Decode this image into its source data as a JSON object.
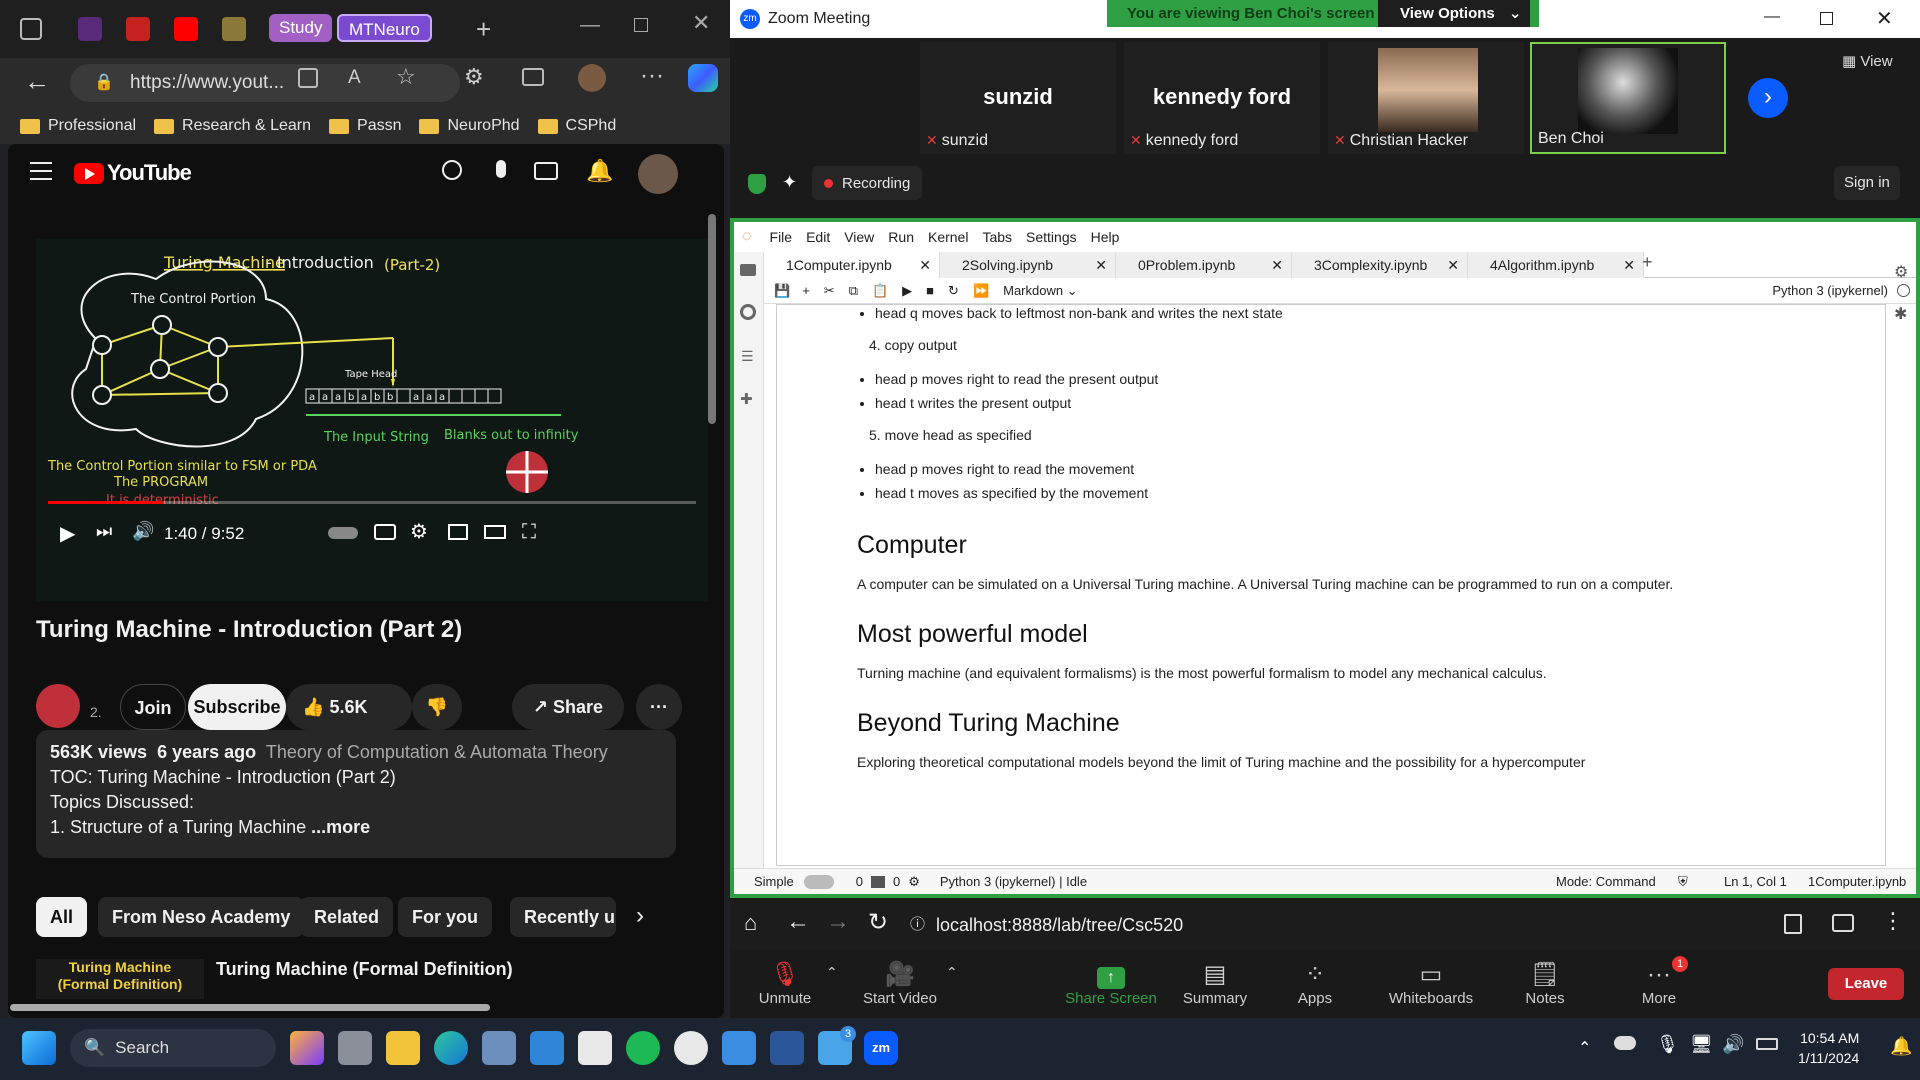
{
  "browser": {
    "group_tabs": [
      "Study",
      "MTNeuro"
    ],
    "url": "https://www.yout...",
    "bookmarks": [
      "Professional",
      "Research & Learn",
      "Passn",
      "NeuroPhd",
      "CSPhd"
    ]
  },
  "youtube": {
    "logo": "YouTube",
    "video": {
      "slide_title": "Turing Machine",
      "slide_title_rest": " - Introduction",
      "slide_part": "(Part-2)",
      "control_portion": "The Control Portion",
      "tape_head": "Tape Head",
      "tape_cells": [
        "a",
        "a",
        "a",
        "b",
        "a",
        "b",
        "b",
        "",
        "a",
        "a",
        "a",
        "",
        "",
        "",
        ""
      ],
      "input_string": "The Input String",
      "blanks": "Blanks out to infinity",
      "note1": "The Control Portion similar to FSM or PDA",
      "note2": "The PROGRAM",
      "note3": "It is deterministic",
      "time": "1:40 / 9:52",
      "progress_fraction": 0.177
    },
    "title": "Turing Machine - Introduction (Part 2)",
    "channel_sub": "2.",
    "join": "Join",
    "subscribe": "Subscribe",
    "likes": "5.6K",
    "share": "Share",
    "description": {
      "views": "563K views",
      "age": "6 years ago",
      "playlist": "Theory of Computation & Automata Theory",
      "line1": "TOC: Turing Machine - Introduction (Part 2)",
      "line2": "Topics Discussed:",
      "line3": "1. Structure of a Turing Machine",
      "more": "...more"
    },
    "chips": [
      "All",
      "From Neso Academy",
      "Related",
      "For you",
      "Recently upl"
    ],
    "next_video": {
      "thumb_line1": "Turing Machine",
      "thumb_line2": "(Formal Definition)",
      "title": "Turing Machine (Formal Definition)"
    }
  },
  "zoom": {
    "window_title": "Zoom Meeting",
    "banner": "You are viewing Ben Choi's screen",
    "view_options": "View Options",
    "view": "View",
    "participants": [
      {
        "big": "sunzid",
        "label": "sunzid"
      },
      {
        "big": "kennedy ford",
        "label": "kennedy ford"
      },
      {
        "big": "",
        "label": "Christian Hacker"
      },
      {
        "big": "",
        "label": "Ben Choi"
      }
    ],
    "recording": "Recording",
    "sign_in": "Sign in",
    "jupyter": {
      "menu": [
        "File",
        "Edit",
        "View",
        "Run",
        "Kernel",
        "Tabs",
        "Settings",
        "Help"
      ],
      "tabs": [
        "1Computer.ipynb",
        "2Solving.ipynb",
        "0Problem.ipynb",
        "3Complexity.ipynb",
        "4Algorithm.ipynb"
      ],
      "cell_type": "Markdown",
      "kernel": "Python 3 (ipykernel)",
      "content": {
        "b0": "head q moves back to leftmost non-bank and writes the next state",
        "item4": "4. copy output",
        "b1": "head p moves right to read the present output",
        "b2": "head t writes the present output",
        "item5": "5. move head as specified",
        "b3": "head p moves right to read the movement",
        "b4": "head t moves as specified by the movement",
        "h1": "Computer",
        "p1": "A computer can be simulated on a Universal Turing machine. A Universal Turing machine can be programmed to run on a computer.",
        "h2": "Most powerful model",
        "p2": "Turning machine (and equivalent formalisms) is the most powerful formalism to model any mechanical calculus.",
        "h3": "Beyond Turing Machine",
        "p3": "Exploring theoretical computational models beyond the limit of Turing machine and the possibility for a hypercomputer"
      },
      "status": {
        "simple": "Simple",
        "n1": "0",
        "n2": "0",
        "kernel_state": "Python 3 (ipykernel) | Idle",
        "mode": "Mode: Command",
        "pos": "Ln 1, Col 1",
        "file": "1Computer.ipynb"
      }
    },
    "addr": "localhost:8888/lab/tree/Csc520",
    "controls": [
      "Unmute",
      "Start Video",
      "Share Screen",
      "Summary",
      "Apps",
      "Whiteboards",
      "Notes",
      "More"
    ],
    "more_badge": "1",
    "leave": "Leave"
  },
  "taskbar": {
    "search": "Search",
    "badge": "3",
    "time": "10:54 AM",
    "date": "1/11/2024"
  },
  "colors": {
    "zoom_green": "#2ea043",
    "yt_red": "#ff0000",
    "leave_red": "#c4262e",
    "zoom_blue": "#0b5cff"
  }
}
